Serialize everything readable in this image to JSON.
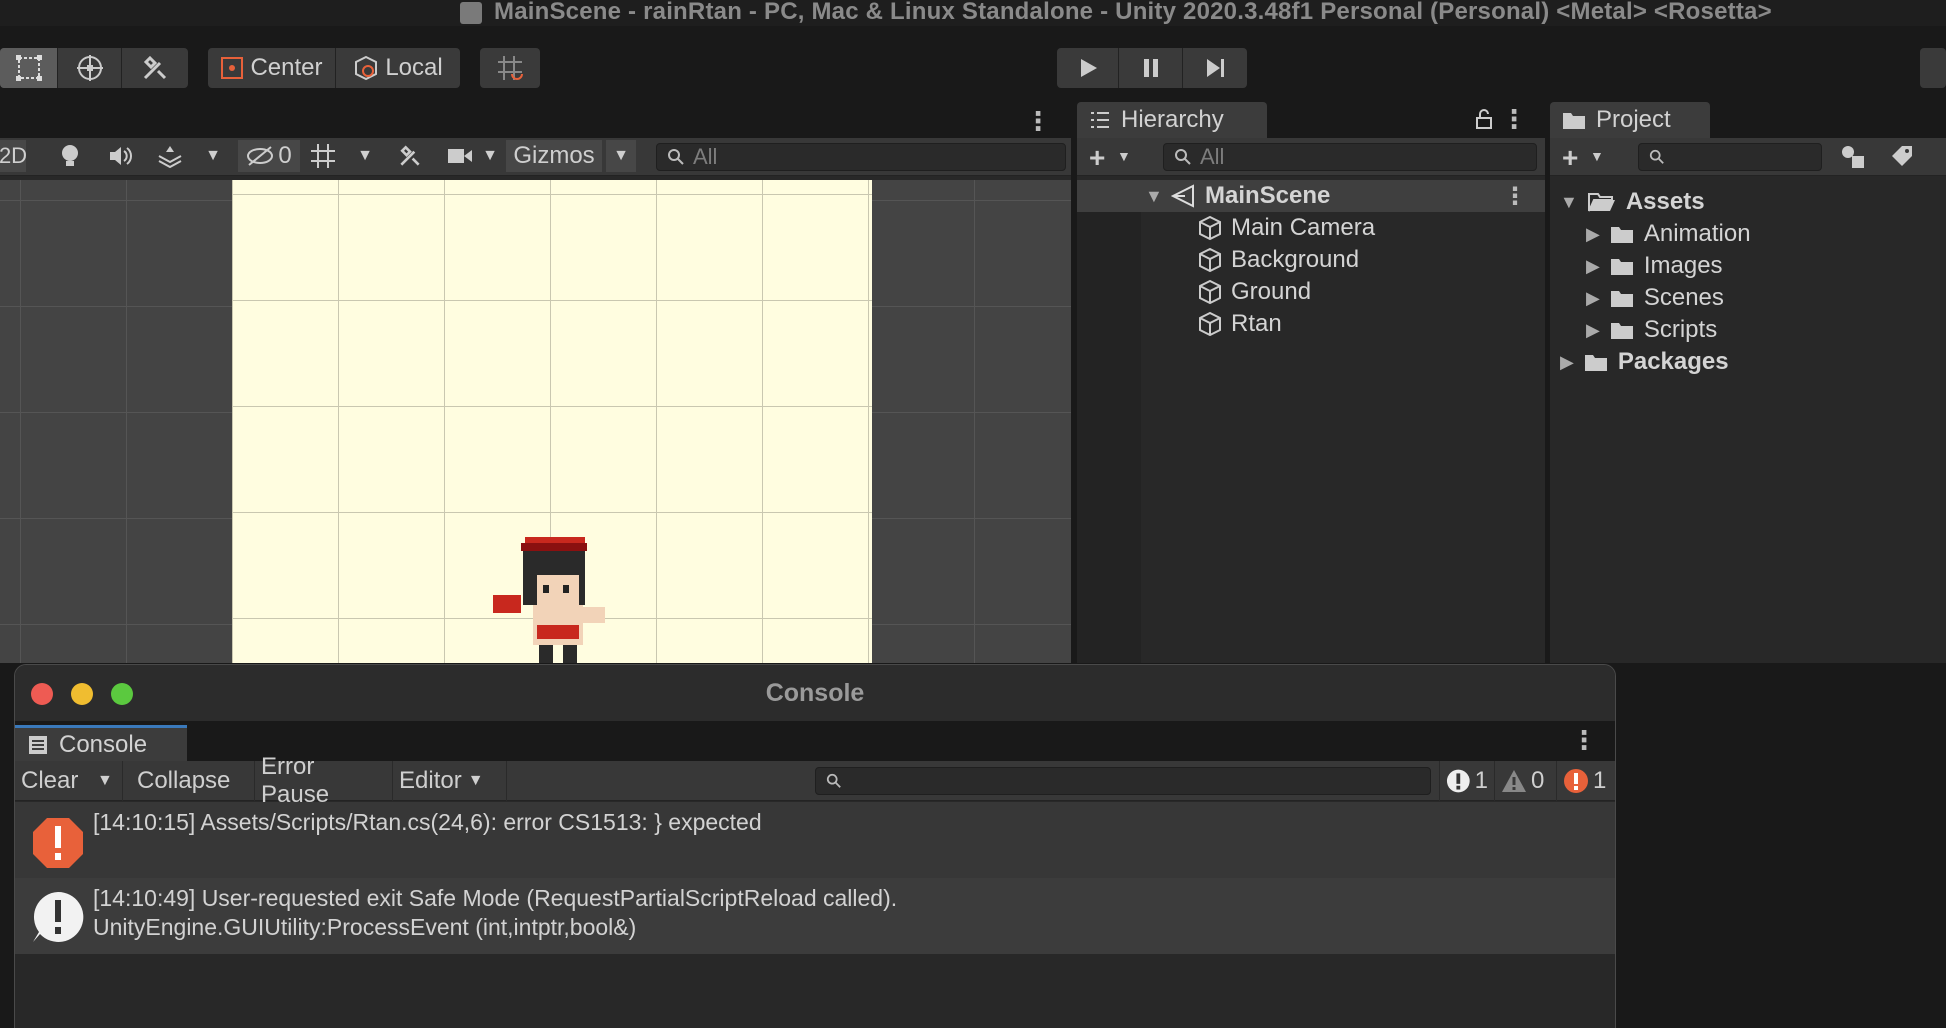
{
  "window": {
    "title": "MainScene - rainRtan - PC, Mac & Linux Standalone - Unity 2020.3.48f1 Personal (Personal) <Metal> <Rosetta>"
  },
  "toolbar": {
    "pivot_center_label": "Center",
    "pivot_local_label": "Local"
  },
  "scene": {
    "mode_2d_label": "2D",
    "hidden_count": "0",
    "gizmos_label": "Gizmos",
    "search_placeholder": "All"
  },
  "hierarchy": {
    "tab_label": "Hierarchy",
    "search_placeholder": "All",
    "scene_name": "MainScene",
    "items": [
      {
        "label": "Main Camera"
      },
      {
        "label": "Background"
      },
      {
        "label": "Ground"
      },
      {
        "label": "Rtan"
      }
    ]
  },
  "project": {
    "tab_label": "Project",
    "tree": {
      "assets_label": "Assets",
      "folders": [
        {
          "label": "Animation"
        },
        {
          "label": "Images"
        },
        {
          "label": "Scenes"
        },
        {
          "label": "Scripts"
        }
      ],
      "packages_label": "Packages"
    }
  },
  "console": {
    "window_title": "Console",
    "tab_label": "Console",
    "clear_label": "Clear",
    "collapse_label": "Collapse",
    "error_pause_label": "Error Pause",
    "editor_label": "Editor",
    "info_count": "1",
    "warning_count": "0",
    "error_count": "1",
    "entries": [
      {
        "type": "error",
        "line1": "[14:10:15] Assets/Scripts/Rtan.cs(24,6): error CS1513: } expected",
        "line2": ""
      },
      {
        "type": "info",
        "line1": "[14:10:49] User-requested exit Safe Mode (RequestPartialScriptReload called).",
        "line2": "UnityEngine.GUIUtility:ProcessEvent (int,intptr,bool&)"
      }
    ]
  },
  "colors": {
    "error": "#e8613a",
    "selection_accent": "#3a79bb",
    "camera_bg": "#fffde0"
  }
}
